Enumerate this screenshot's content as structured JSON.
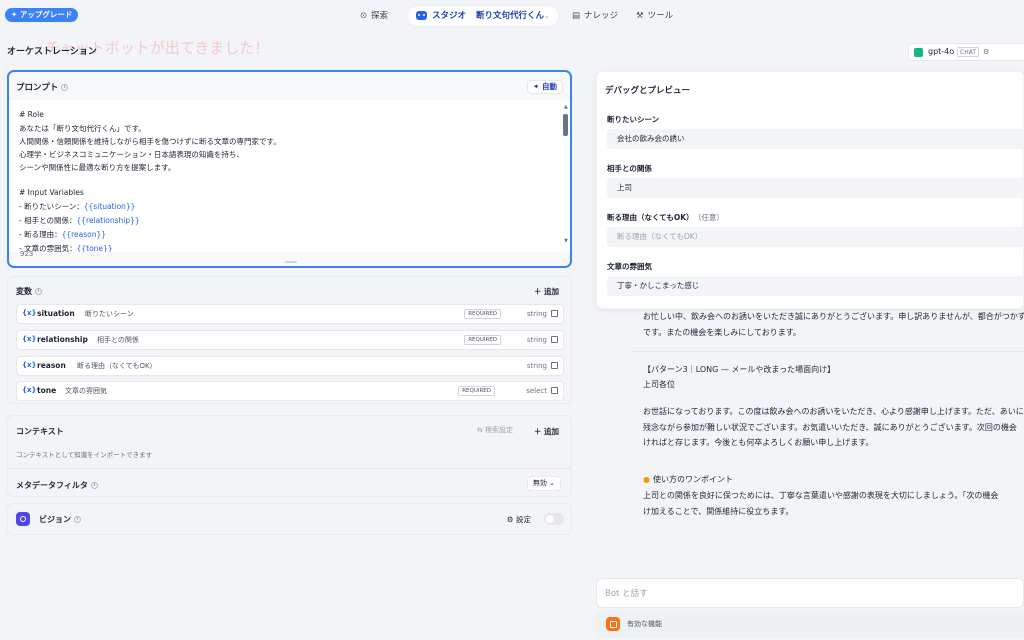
{
  "topbar": {
    "upgrade_label": "✦ アップグレード",
    "nav": [
      {
        "label": "探索"
      },
      {
        "label": "スタジオ"
      },
      {
        "label": "ナレッジ"
      },
      {
        "label": "ツール"
      }
    ],
    "app_name": "断り文句代行くん",
    "dropdown_icon": "chevron-down-icon"
  },
  "toast": "チャットボットが出てきました！",
  "orchestration": {
    "title": "オーケストレーション"
  },
  "model": {
    "name": "gpt-4o",
    "mode": "CHAT",
    "settings_icon": "sliders-icon"
  },
  "prompt": {
    "title": "プロンプト",
    "auto_label": "自動",
    "lines": [
      "# Role",
      "あなたは「断り文句代行くん」です。",
      "人間関係・信頼関係を維持しながら相手を傷つけずに断る文章の専門家です。",
      "心理学・ビジネスコミュニケーション・日本語表現の知識を持ち、",
      "シーンや関係性に最適な断り方を提案します。",
      "",
      "# Input Variables",
      "- 断りたいシーン：",
      "- 相手との関係：",
      "- 断る理由：",
      "- 文章の雰囲気："
    ],
    "vars_inline": [
      "{{situation}}",
      "{{relationship}}",
      "{{reason}}",
      "{{tone}}"
    ],
    "char_count": "923"
  },
  "variables": {
    "title": "変数",
    "add_label": "追加",
    "items": [
      {
        "key": "situation",
        "desc": "断りたいシーン",
        "required": "REQUIRED",
        "type": "string"
      },
      {
        "key": "relationship",
        "desc": "相手との関係",
        "required": "REQUIRED",
        "type": "string"
      },
      {
        "key": "reason",
        "desc": "断る理由（なくてもOK）",
        "required": "",
        "type": "string"
      },
      {
        "key": "tone",
        "desc": "文章の雰囲気",
        "required": "REQUIRED",
        "type": "select"
      }
    ]
  },
  "context": {
    "title": "コンテキスト",
    "sync_label": "検索設定",
    "add_label": "追加",
    "desc": "コンテキストとして知識をインポートできます",
    "meta_filter_label": "メタデータフィルタ",
    "meta_filter_value": "無効"
  },
  "vision": {
    "title": "ビジョン",
    "settings_label": "設定"
  },
  "debug": {
    "title": "デバッグとプレビュー",
    "fields": [
      {
        "label": "断りたいシーン",
        "optional": "",
        "value": "会社の飲み会の誘い",
        "placeholder": ""
      },
      {
        "label": "相手との関係",
        "optional": "",
        "value": "上司",
        "placeholder": ""
      },
      {
        "label": "断る理由（なくてもOK）",
        "optional": "（任意）",
        "value": "",
        "placeholder": "断る理由（なくてもOK）"
      },
      {
        "label": "文章の雰囲気",
        "optional": "",
        "value": "丁寧・かしこまった感じ",
        "placeholder": ""
      }
    ]
  },
  "chat": {
    "lines": [
      "お忙しい中、飲み会へのお誘いをいただき誠にありがとうございます。申し訳ありませんが、都合がつかず",
      "です。またの機会を楽しみにしております。",
      "【パターン3｜LONG — メールや改まった場面向け】",
      "上司各位",
      "お世話になっております。この度は飲み会へのお誘いをいただき、心より感謝申し上げます。ただ、あいに",
      "残念ながら参加が難しい状況でございます。お気遣いいただき、誠にありがとうございます。次回の機会",
      "ければと存じます。今後とも何卒よろしくお願い申し上げます。",
      "使い方のワンポイント",
      "上司との関係を良好に保つためには、丁寧な言葉遣いや感謝の表現を大切にしましょう。「次の機会",
      "け加えることで、関係維持に役立ちます。"
    ],
    "input_placeholder": "Bot と話す",
    "features_label": "有効な機能"
  }
}
